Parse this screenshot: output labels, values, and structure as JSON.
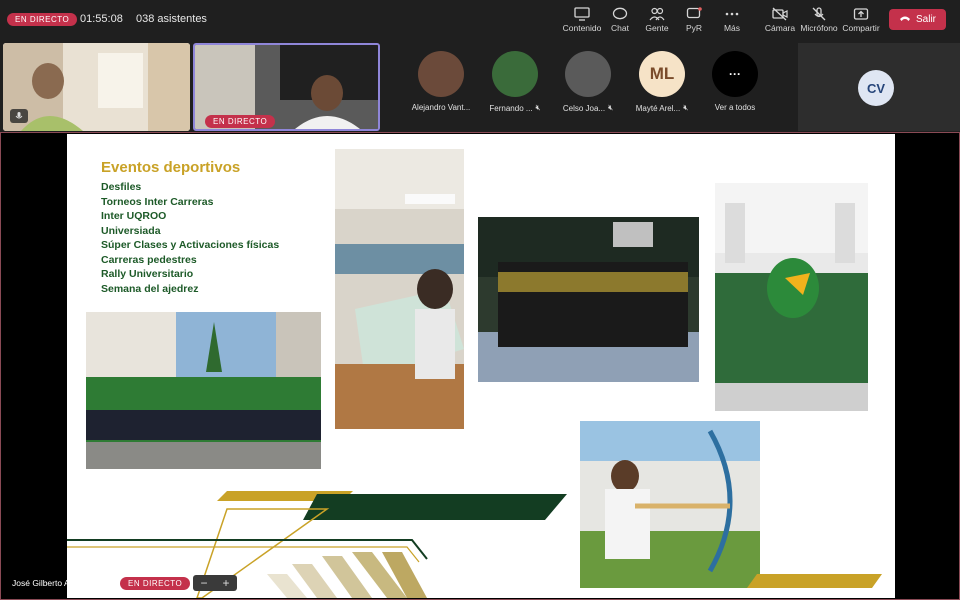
{
  "topbar": {
    "live_label": "EN DIRECTO",
    "timer": "01:55:08",
    "attendees": "038 asistentes",
    "buttons": [
      {
        "label": "Contenido",
        "icon": "share-screen-icon"
      },
      {
        "label": "Chat",
        "icon": "chat-icon"
      },
      {
        "label": "Gente",
        "icon": "people-icon"
      },
      {
        "label": "PyR",
        "icon": "qna-icon"
      },
      {
        "label": "Más",
        "icon": "more-icon"
      },
      {
        "label": "Cámara",
        "icon": "camera-off-icon"
      },
      {
        "label": "Micrófono",
        "icon": "mic-off-icon"
      },
      {
        "label": "Compartir",
        "icon": "share-icon"
      }
    ],
    "leave_label": "Salir"
  },
  "video_strip": {
    "tile2_live_label": "EN DIRECTO",
    "participants": [
      {
        "name": "Alejandro Vant...",
        "initials": "",
        "muted": false,
        "color": "#6b4a3a"
      },
      {
        "name": "Fernando ...",
        "initials": "",
        "muted": true,
        "color": "#3a6b3a"
      },
      {
        "name": "Celso Joa...",
        "initials": "",
        "muted": true,
        "color": "#5a5a5a"
      },
      {
        "name": "Mayté Arel...",
        "initials": "ML",
        "muted": true,
        "color": "#f6e3c7"
      },
      {
        "name": "Ver a todos",
        "initials": "···",
        "muted": false,
        "color": "#000000"
      }
    ],
    "cv_initials": "CV"
  },
  "slide": {
    "title": "Eventos deportivos",
    "items": [
      "Desfiles",
      "Torneos Inter Carreras",
      "Inter UQROO",
      "Universiada",
      "Súper Clases y Activaciones físicas",
      "Carreras pedestres",
      "Rally Universitario",
      "Semana del ajedrez"
    ],
    "colors": {
      "gold": "#c9a227",
      "green": "#1d5a28",
      "dark_green": "#133d22"
    }
  },
  "bottombar": {
    "presenter_name": "José Gilberto Aguilar Cano",
    "live_label": "EN DIRECTO",
    "zoom_out": "−",
    "zoom_in": "+"
  }
}
